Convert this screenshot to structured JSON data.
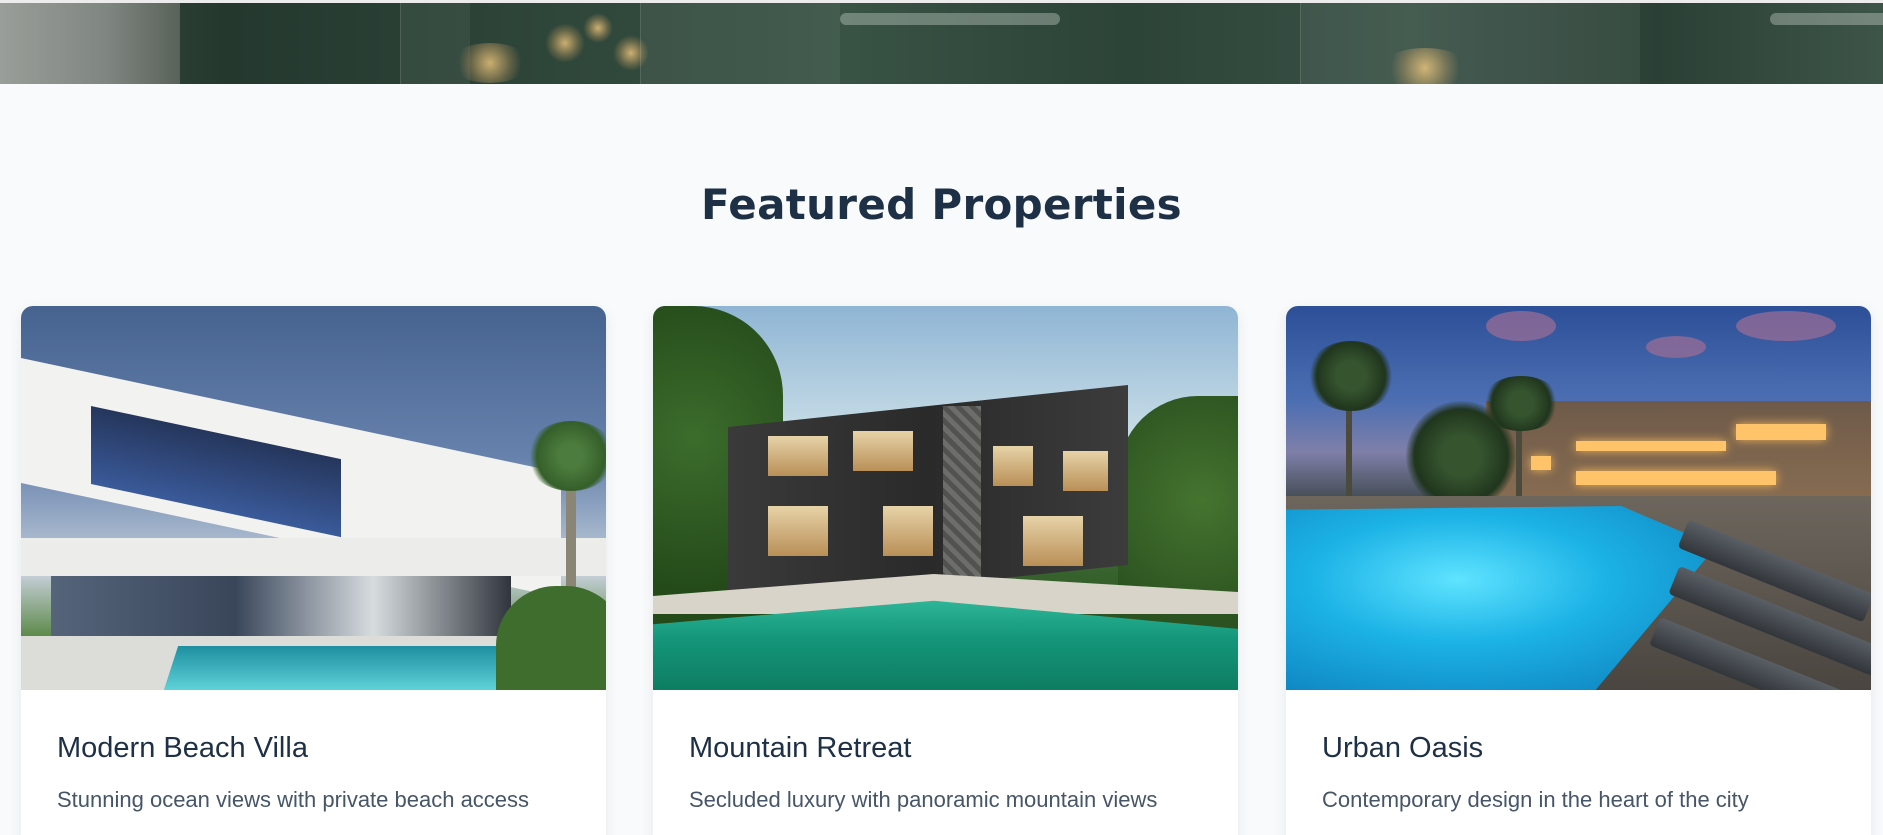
{
  "section": {
    "title": "Featured Properties"
  },
  "properties": [
    {
      "title": "Modern Beach Villa",
      "description": "Stunning ocean views with private beach access"
    },
    {
      "title": "Mountain Retreat",
      "description": "Secluded luxury with panoramic mountain views"
    },
    {
      "title": "Urban Oasis",
      "description": "Contemporary design in the heart of the city"
    }
  ],
  "colors": {
    "page_background": "#f8fafc",
    "heading": "#1e3046",
    "body_text": "#475569",
    "card_background": "#ffffff"
  }
}
